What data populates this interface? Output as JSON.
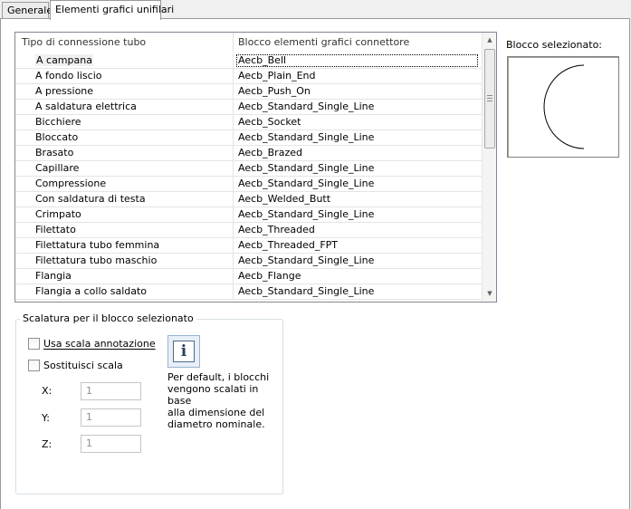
{
  "tabs": [
    {
      "label": "Generale",
      "active": false
    },
    {
      "label": "Elementi grafici unifilari",
      "active": true
    }
  ],
  "table": {
    "columns": [
      "Tipo di connessione tubo",
      "Blocco elementi grafici connettore"
    ],
    "rows": [
      [
        "A campana",
        "Aecb_Bell"
      ],
      [
        "A fondo liscio",
        "Aecb_Plain_End"
      ],
      [
        "A pressione",
        "Aecb_Push_On"
      ],
      [
        "A saldatura elettrica",
        "Aecb_Standard_Single_Line"
      ],
      [
        "Bicchiere",
        "Aecb_Socket"
      ],
      [
        "Bloccato",
        "Aecb_Standard_Single_Line"
      ],
      [
        "Brasato",
        "Aecb_Brazed"
      ],
      [
        "Capillare",
        "Aecb_Standard_Single_Line"
      ],
      [
        "Compressione",
        "Aecb_Standard_Single_Line"
      ],
      [
        "Con saldatura di testa",
        "Aecb_Welded_Butt"
      ],
      [
        "Crimpato",
        "Aecb_Standard_Single_Line"
      ],
      [
        "Filettato",
        "Aecb_Threaded"
      ],
      [
        "Filettatura tubo femmina",
        "Aecb_Threaded_FPT"
      ],
      [
        "Filettatura tubo maschio",
        "Aecb_Standard_Single_Line"
      ],
      [
        "Flangia",
        "Aecb_Flange"
      ],
      [
        "Flangia a collo saldato",
        "Aecb_Standard_Single_Line"
      ]
    ],
    "selected_row": 0
  },
  "preview": {
    "label": "Blocco selezionato:"
  },
  "scaling": {
    "title": "Scalatura per il blocco selezionato",
    "use_annotation_scale": {
      "label": "Usa scala annotazione",
      "checked": false
    },
    "override_scale": {
      "label": "Sostituisci scala",
      "checked": false
    },
    "x": {
      "label": "X:",
      "value": "1"
    },
    "y": {
      "label": "Y:",
      "value": "1"
    },
    "z": {
      "label": "Z:",
      "value": "1"
    },
    "info_icon": "info-icon",
    "info_text": "Per default, i blocchi\nvengono scalati in base\nalla dimensione del\ndiametro nominale."
  }
}
